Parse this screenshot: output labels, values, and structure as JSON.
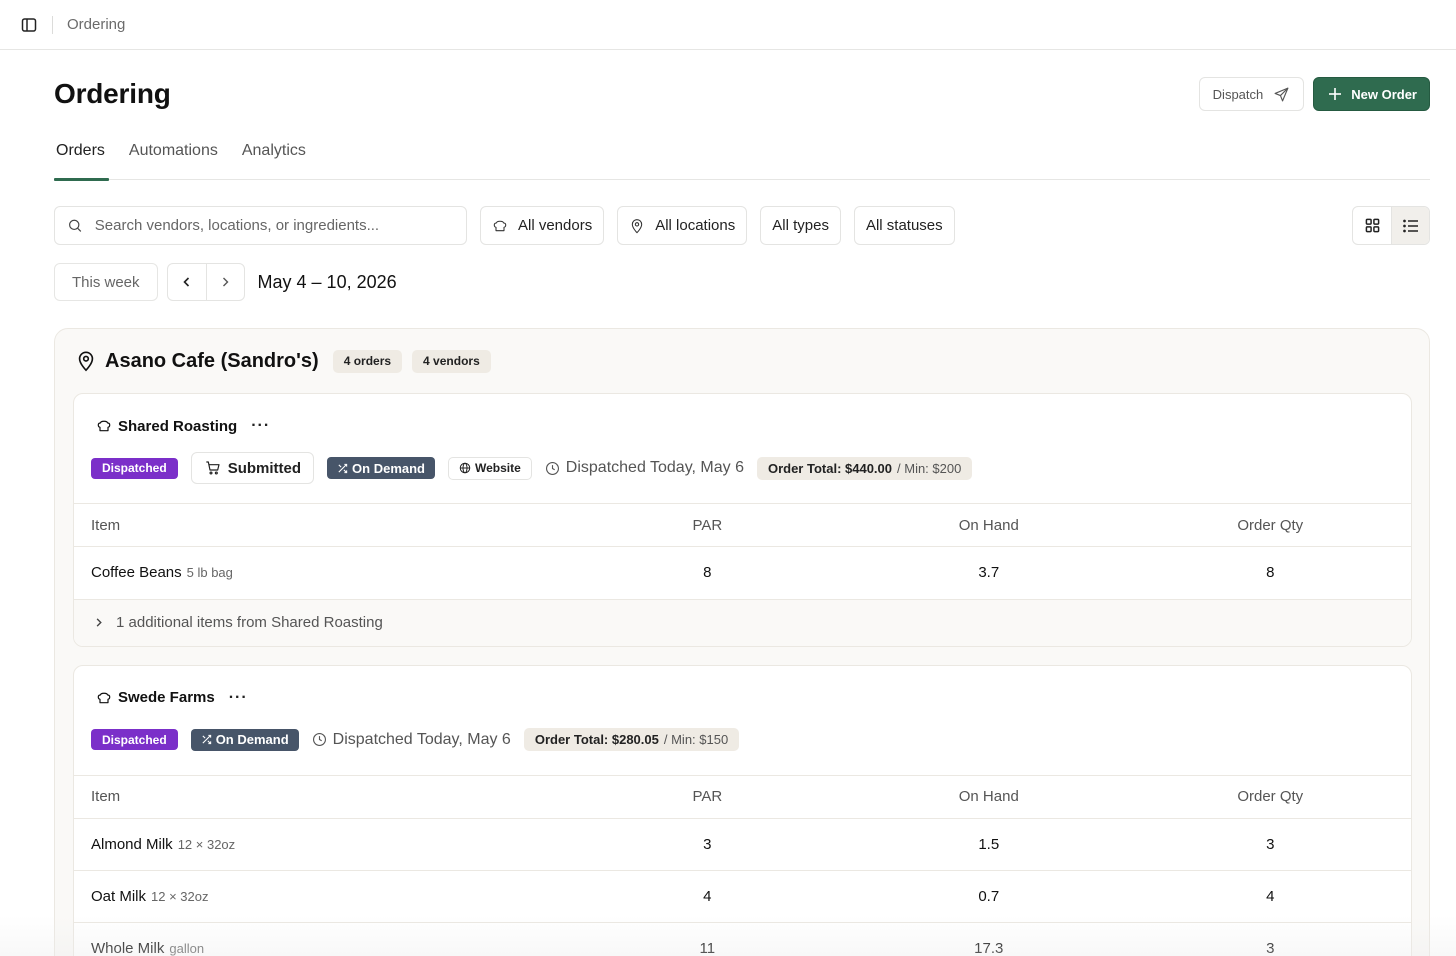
{
  "topbar": {
    "breadcrumb": "Ordering"
  },
  "header": {
    "title": "Ordering",
    "dispatch_label": "Dispatch",
    "new_order_label": "New Order"
  },
  "tabs": [
    {
      "label": "Orders",
      "active": true
    },
    {
      "label": "Automations",
      "active": false
    },
    {
      "label": "Analytics",
      "active": false
    }
  ],
  "filters": {
    "search_placeholder": "Search vendors, locations, or ingredients...",
    "vendors": "All vendors",
    "locations": "All locations",
    "types": "All types",
    "statuses": "All statuses",
    "view_mode": "list"
  },
  "week": {
    "this_week_label": "This week",
    "range": "May 4 – 10, 2026"
  },
  "location": {
    "name": "Asano Cafe (Sandro's)",
    "orders_count": "4 orders",
    "vendors_count": "4 vendors",
    "vendors": [
      {
        "name": "Shared Roasting",
        "status": "Dispatched",
        "submitted": "Submitted",
        "type": "On Demand",
        "channel": "Website",
        "dispatched_at": "Dispatched Today, May 6",
        "order_total": "Order Total: $440.00",
        "minimum": "/ Min: $200",
        "columns": [
          "Item",
          "PAR",
          "On Hand",
          "Order Qty"
        ],
        "items": [
          {
            "name": "Coffee Beans",
            "unit": "5 lb bag",
            "par": "8",
            "on_hand": "3.7",
            "order_qty": "8"
          }
        ],
        "more_items": "1 additional items from Shared Roasting"
      },
      {
        "name": "Swede Farms",
        "status": "Dispatched",
        "type": "On Demand",
        "dispatched_at": "Dispatched Today, May 6",
        "order_total": "Order Total: $280.05",
        "minimum": "/ Min: $150",
        "columns": [
          "Item",
          "PAR",
          "On Hand",
          "Order Qty"
        ],
        "items": [
          {
            "name": "Almond Milk",
            "unit": "12 × 32oz",
            "par": "3",
            "on_hand": "1.5",
            "order_qty": "3"
          },
          {
            "name": "Oat Milk",
            "unit": "12 × 32oz",
            "par": "4",
            "on_hand": "0.7",
            "order_qty": "4"
          },
          {
            "name": "Whole Milk",
            "unit": "gallon",
            "par": "11",
            "on_hand": "17.3",
            "order_qty": "3"
          }
        ]
      }
    ]
  },
  "colors": {
    "accent": "#2f6b4f",
    "dispatched": "#7b2fc9",
    "on_demand": "#475569"
  }
}
